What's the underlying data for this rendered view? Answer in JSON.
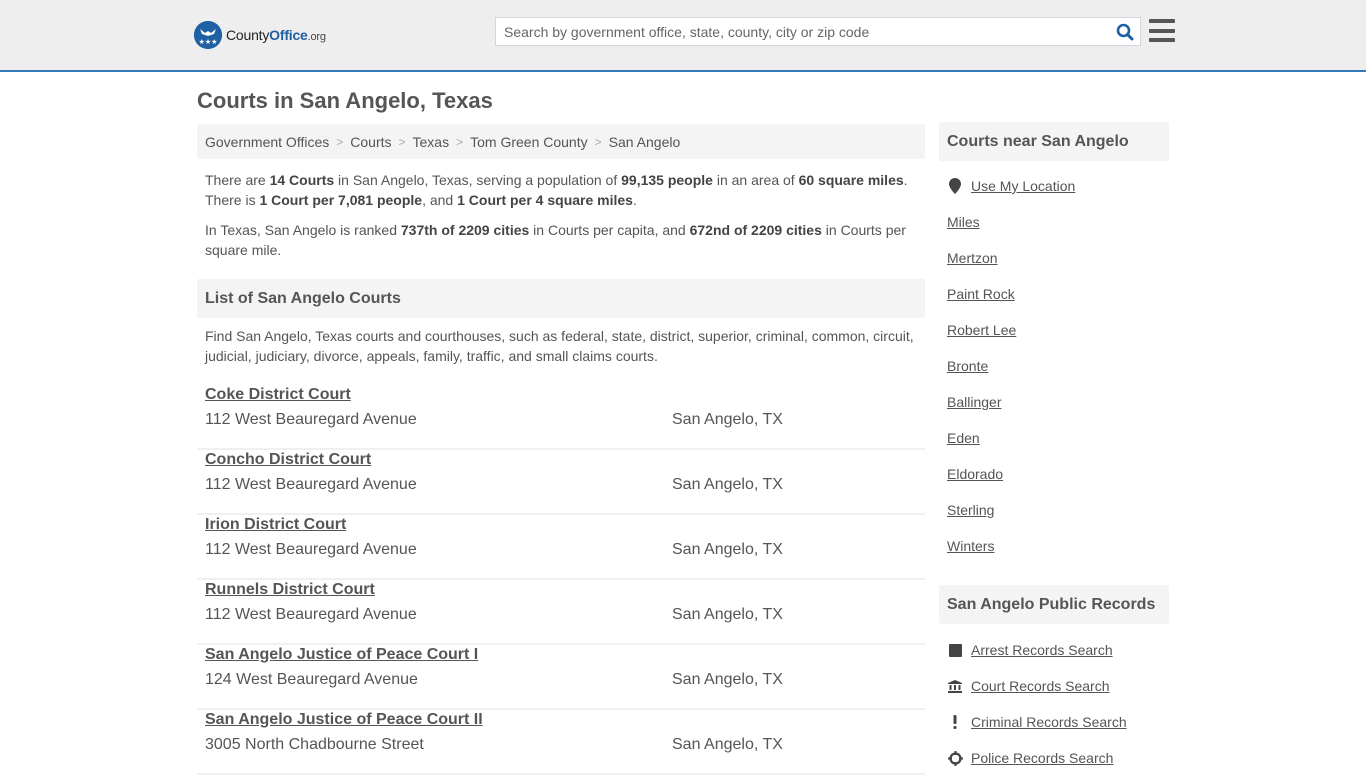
{
  "header": {
    "logo": {
      "name": "County",
      "accent": "Office",
      "tld": ".org"
    },
    "search": {
      "placeholder": "Search by government office, state, county, city or zip code",
      "value": ""
    },
    "accent_color": "#337ab7"
  },
  "page_title": "Courts in San Angelo, Texas",
  "breadcrumb": [
    "Government Offices",
    "Courts",
    "Texas",
    "Tom Green County",
    "San Angelo"
  ],
  "intro": {
    "p1": [
      "There are ",
      "14 Courts",
      " in San Angelo, Texas, serving a population of ",
      "99,135 people",
      " in an area of ",
      "60 square miles",
      ". There is ",
      "1 Court per 7,081 people",
      ", and ",
      "1 Court per 4 square miles",
      "."
    ],
    "p2": [
      "In Texas, San Angelo is ranked ",
      "737th of 2209 cities",
      " in Courts per capita, and ",
      "672nd of 2209 cities",
      " in Courts per square mile."
    ]
  },
  "list_section": {
    "title": "List of San Angelo Courts",
    "description": "Find San Angelo, Texas courts and courthouses, such as federal, state, district, superior, criminal, common, circuit, judicial, judiciary, divorce, appeals, family, traffic, and small claims courts."
  },
  "courts": [
    {
      "name": "Coke District Court",
      "address": "112 West Beauregard Avenue",
      "city": "San Angelo, TX"
    },
    {
      "name": "Concho District Court",
      "address": "112 West Beauregard Avenue",
      "city": "San Angelo, TX"
    },
    {
      "name": "Irion District Court",
      "address": "112 West Beauregard Avenue",
      "city": "San Angelo, TX"
    },
    {
      "name": "Runnels District Court",
      "address": "112 West Beauregard Avenue",
      "city": "San Angelo, TX"
    },
    {
      "name": "San Angelo Justice of Peace Court I",
      "address": "124 West Beauregard Avenue",
      "city": "San Angelo, TX"
    },
    {
      "name": "San Angelo Justice of Peace Court II",
      "address": "3005 North Chadbourne Street",
      "city": "San Angelo, TX"
    }
  ],
  "sidebar": {
    "near": {
      "title": "Courts near San Angelo",
      "use_location": "Use My Location",
      "cities": [
        "Miles",
        "Mertzon",
        "Paint Rock",
        "Robert Lee",
        "Bronte",
        "Ballinger",
        "Eden",
        "Eldorado",
        "Sterling",
        "Winters"
      ]
    },
    "records": {
      "title": "San Angelo Public Records",
      "items": [
        {
          "label": "Arrest Records Search",
          "icon": "square-icon"
        },
        {
          "label": "Court Records Search",
          "icon": "courthouse-icon"
        },
        {
          "label": "Criminal Records Search",
          "icon": "exclamation-icon"
        },
        {
          "label": "Police Records Search",
          "icon": "crosshair-icon"
        }
      ]
    }
  }
}
